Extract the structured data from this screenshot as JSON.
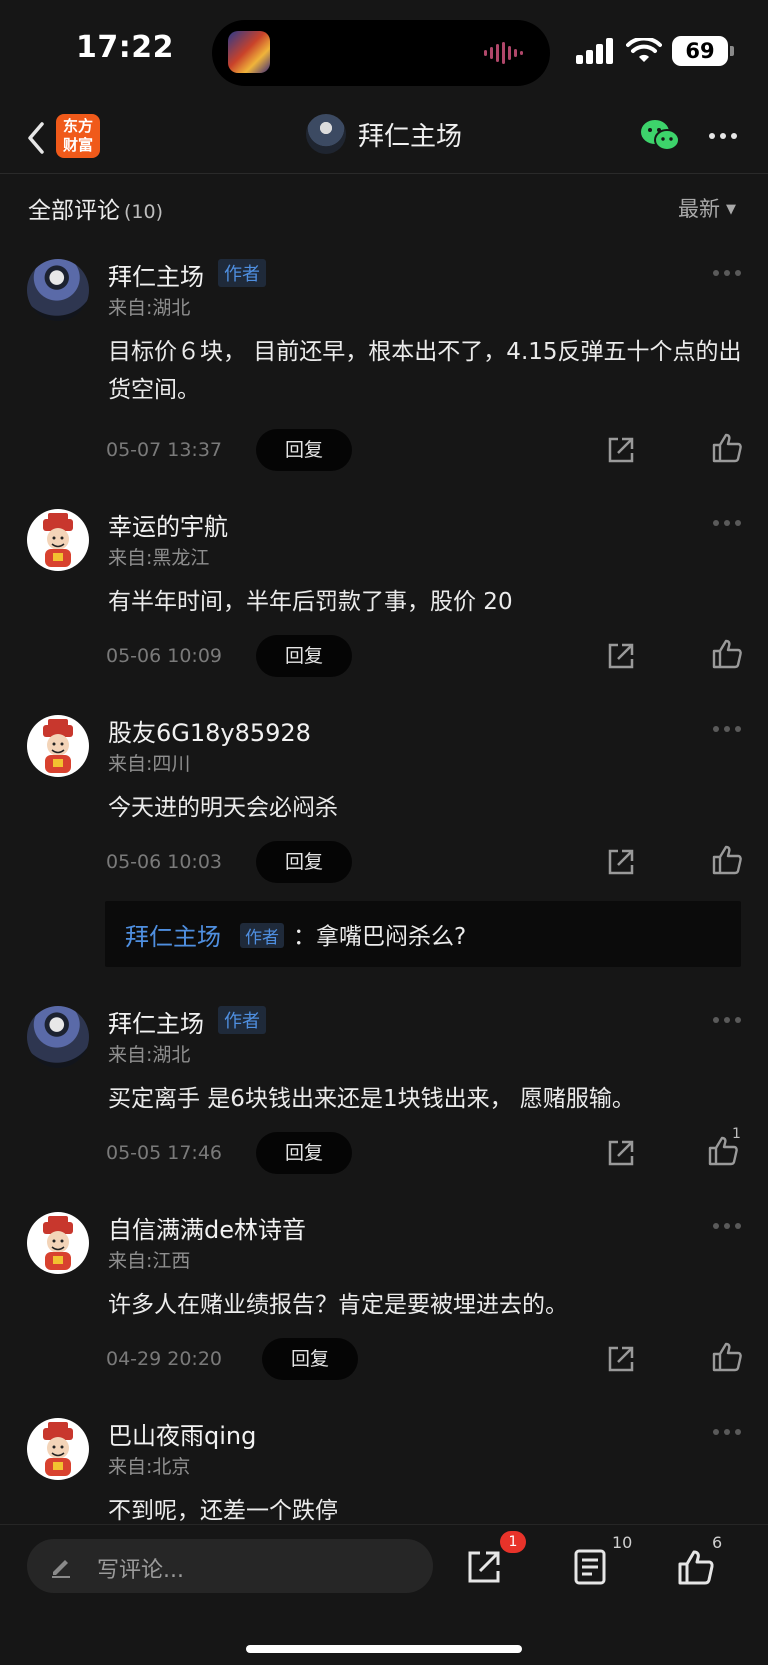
{
  "status_bar": {
    "time": "17:22",
    "battery": "69"
  },
  "nav": {
    "brand_line1": "东方",
    "brand_line2": "财富",
    "title": "拜仁主场"
  },
  "section": {
    "title": "全部评论",
    "count": "(10)",
    "sort": "最新"
  },
  "comments": [
    {
      "user": "拜仁主场",
      "tag": "作者",
      "location": "来自:湖北",
      "text": "目标价６块，  目前还早，根本出不了，4.15反弹五十个点的出货空间。",
      "time": "05-07 13:37",
      "reply": "回复"
    },
    {
      "user": "幸运的宇航",
      "location": "来自:黑龙江",
      "text": "有半年时间，半年后罚款了事，股价 20",
      "time": "05-06 10:09",
      "reply": "回复"
    },
    {
      "user": "股友6G18y85928",
      "location": "来自:四川",
      "text": "今天进的明天会必闷杀",
      "time": "05-06 10:03",
      "reply": "回复",
      "sub_reply": {
        "user": "拜仁主场",
        "tag": "作者",
        "text": "拿嘴巴闷杀么?"
      }
    },
    {
      "user": "拜仁主场",
      "tag": "作者",
      "location": "来自:湖北",
      "text": "买定离手   是6块钱出来还是1块钱出来， 愿赌服输。",
      "time": "05-05 17:46",
      "reply": "回复",
      "likes": "1"
    },
    {
      "user": "自信满满de林诗音",
      "location": "来自:江西",
      "text": "许多人在赌业绩报告？肯定是要被埋进去的。",
      "time": "04-29 20:20",
      "reply": "回复"
    },
    {
      "user": "巴山夜雨qing",
      "location": "来自:北京",
      "text": "不到呢，还差一个跌停"
    }
  ],
  "bottom_bar": {
    "placeholder": "写评论...",
    "share_badge": "1",
    "comments_count": "10",
    "likes_count": "6"
  },
  "colors": {
    "accent_blue": "#4f8fe0",
    "brand_orange": "#f05a1a",
    "badge_red": "#e8332a",
    "wechat_green": "#3dd36b"
  }
}
